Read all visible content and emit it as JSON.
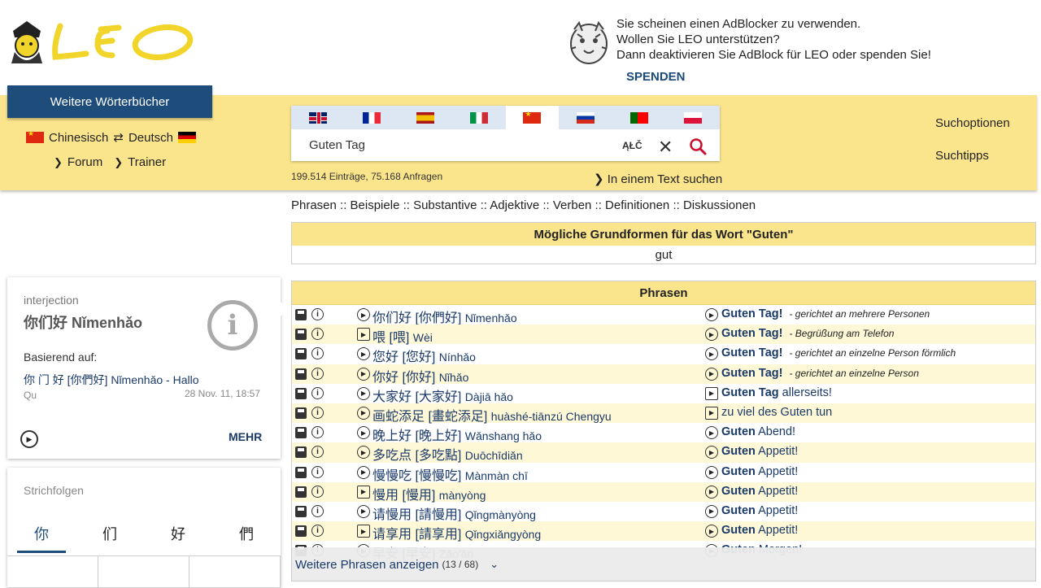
{
  "header": {
    "logo_text": "LEO",
    "adblock_lines": [
      "Sie scheinen einen AdBlocker zu verwenden.",
      "Wollen Sie LEO unterstützen?",
      "Dann deaktivieren Sie AdBlock für LEO oder spenden Sie!"
    ],
    "spenden": "SPENDEN"
  },
  "sidebar_nav": {
    "weitere": "Weitere Wörterbücher",
    "lang_from": "Chinesisch",
    "swap": "⇄",
    "lang_to": "Deutsch",
    "forum": "Forum",
    "trainer": "Trainer"
  },
  "search": {
    "flags": [
      "gb",
      "fr",
      "es",
      "it",
      "cn",
      "ru",
      "pt",
      "pl"
    ],
    "active_flag": "cn",
    "value": "Guten Tag",
    "alc": "ĄŁČ",
    "stats": "199.514 Einträge, 75.168 Anfragen",
    "in_text": "In einem Text suchen"
  },
  "options": {
    "suchoptionen": "Suchoptionen",
    "suchtipps": "Suchtipps"
  },
  "sections": "Phrasen :: Beispiele :: Substantive :: Adjektive :: Verben :: Definitionen :: Diskussionen",
  "grundformen": {
    "title": "Mögliche Grundformen für das Wort \"Guten\"",
    "value": "gut"
  },
  "phrasen": {
    "title": "Phrasen",
    "rows": [
      {
        "zh": "你们好 [你們好]",
        "py": "Nǐmenhǎo",
        "de_b": "Guten Tag!",
        "de_rest": "",
        "note": "- gerichtet an mehrere Personen",
        "sq1": false,
        "sq2": false
      },
      {
        "zh": "喂 [喂]",
        "py": "Wèi",
        "de_b": "Guten Tag!",
        "de_rest": "",
        "note": "- Begrüßung am Telefon",
        "sq1": true,
        "sq2": false
      },
      {
        "zh": "您好 [您好]",
        "py": "Nínhǎo",
        "de_b": "Guten Tag!",
        "de_rest": "",
        "note": "- gerichtet an einzelne Person förmlich",
        "sq1": false,
        "sq2": false
      },
      {
        "zh": "你好 [你好]",
        "py": "Nǐhǎo",
        "de_b": "Guten Tag!",
        "de_rest": "",
        "note": "- gerichtet an einzelne Person",
        "sq1": false,
        "sq2": false
      },
      {
        "zh": "大家好 [大家好]",
        "py": "Dàjiā hǎo",
        "de_b": "Guten Tag",
        "de_rest": " allerseits!",
        "note": "",
        "sq1": false,
        "sq2": true
      },
      {
        "zh": "画蛇添足 [畫蛇添足]",
        "py": "huàshé-tiānzú  Chengyu",
        "de_b": "",
        "de_rest": "zu viel des Guten tun",
        "note": "",
        "sq1": false,
        "sq2": true
      },
      {
        "zh": "晚上好 [晚上好]",
        "py": "Wǎnshang hǎo",
        "de_b": "Guten",
        "de_rest": " Abend!",
        "note": "",
        "sq1": false,
        "sq2": false
      },
      {
        "zh": "多吃点 [多吃點]",
        "py": "Duōchīdiǎn",
        "de_b": "Guten",
        "de_rest": " Appetit!",
        "note": "",
        "sq1": false,
        "sq2": false
      },
      {
        "zh": "慢慢吃 [慢慢吃]",
        "py": "Mànmàn chī",
        "de_b": "Guten",
        "de_rest": " Appetit!",
        "note": "",
        "sq1": false,
        "sq2": false
      },
      {
        "zh": "慢用 [慢用]",
        "py": "mànyòng",
        "de_b": "Guten",
        "de_rest": " Appetit!",
        "note": "",
        "sq1": true,
        "sq2": false
      },
      {
        "zh": "请慢用 [請慢用]",
        "py": "Qǐngmànyòng",
        "de_b": "Guten",
        "de_rest": " Appetit!",
        "note": "",
        "sq1": false,
        "sq2": false
      },
      {
        "zh": "请享用 [請享用]",
        "py": "Qǐngxiǎngyòng",
        "de_b": "Guten",
        "de_rest": " Appetit!",
        "note": "",
        "sq1": true,
        "sq2": false
      },
      {
        "zh": "早安 [早安]",
        "py": "Zǎo'ān",
        "de_b": "Guten",
        "de_rest": " Morgen!",
        "note": "",
        "sq1": false,
        "sq2": false
      }
    ],
    "more_label": "Weitere Phrasen anzeigen",
    "more_count": "(13 / 68)"
  },
  "card1": {
    "type": "interjection",
    "word": "你们好 Nǐmenhǎo",
    "basis": "Basierend auf:",
    "example": "你 门 好  [你們好]   Nǐmenhǎo - Hallo",
    "qu": "Qu",
    "date": "28 Nov. 11, 18:57",
    "mehr": "MEHR"
  },
  "card2": {
    "title": "Strichfolgen",
    "tabs": [
      "你",
      "们",
      "好",
      "們"
    ]
  }
}
